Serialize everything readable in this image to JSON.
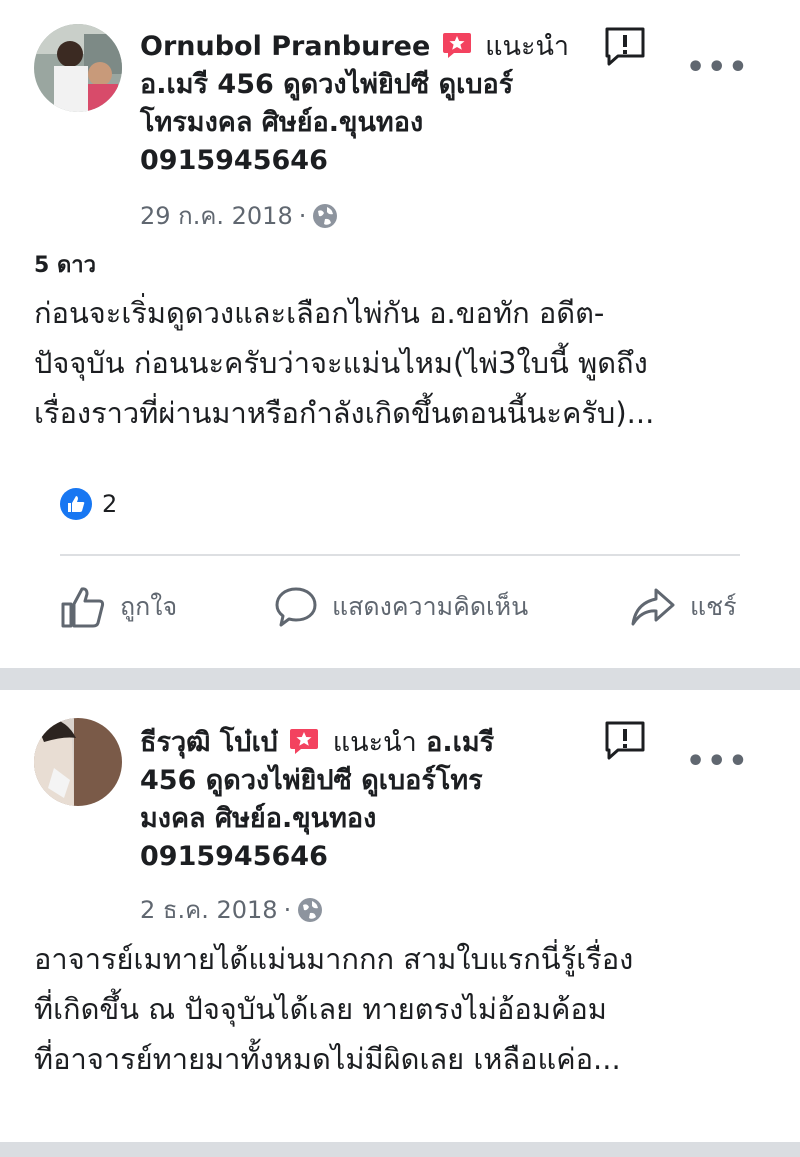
{
  "posts": [
    {
      "author": "Ornubol Pranburee",
      "recommend_label": "แนะนำ",
      "page_line1": "อ.เมรี 456 ดูดวงไพ่ยิปซี ดูเบอร์",
      "page_line2": "โทรมงคล ศิษย์อ.ขุนทอง",
      "phone": "0915945646",
      "date": "29 ก.ค. 2018",
      "rating": "5 ดาว",
      "text_line1": "ก่อนจะเริ่มดูดวงและเลือกไพ่กัน อ.ขอทัก อดีต-",
      "text_line2": "ปัจจุบัน ก่อนนะครับว่าจะแม่นไหม(ไพ่3ใบนี้ พูดถึง",
      "text_line3": "เรื่องราวที่ผ่านมาหรือกำลังเกิดขึ้นตอนนี้นะครับ)...",
      "like_count": "2",
      "actions": {
        "like": "ถูกใจ",
        "comment": "แสดงความคิดเห็น",
        "share": "แชร์"
      }
    },
    {
      "author": "ธีรวุฒิ โบ๋เบ๋",
      "recommend_label": "แนะนำ",
      "page_line1": "อ.เมรี",
      "page_line2": "456 ดูดวงไพ่ยิปซี ดูเบอร์โทร",
      "page_line3": "มงคล ศิษย์อ.ขุนทอง",
      "phone": "0915945646",
      "date": "2 ธ.ค. 2018",
      "text_line1": "อาจารย์เมทายได้แม่นมากกก สามใบแรกนี่รู้เรื่อง",
      "text_line2": "ที่เกิดขึ้น ณ ปัจจุบันได้เลย ทายตรงไม่อ้อมค้อม",
      "text_line3": "ที่อาจารย์ทายมาทั้งหมดไม่มีผิดเลย เหลือแค่อ..."
    }
  ],
  "icons": {
    "more": "•••",
    "recommend_color": "#f3425f",
    "like_color": "#1877f2"
  }
}
